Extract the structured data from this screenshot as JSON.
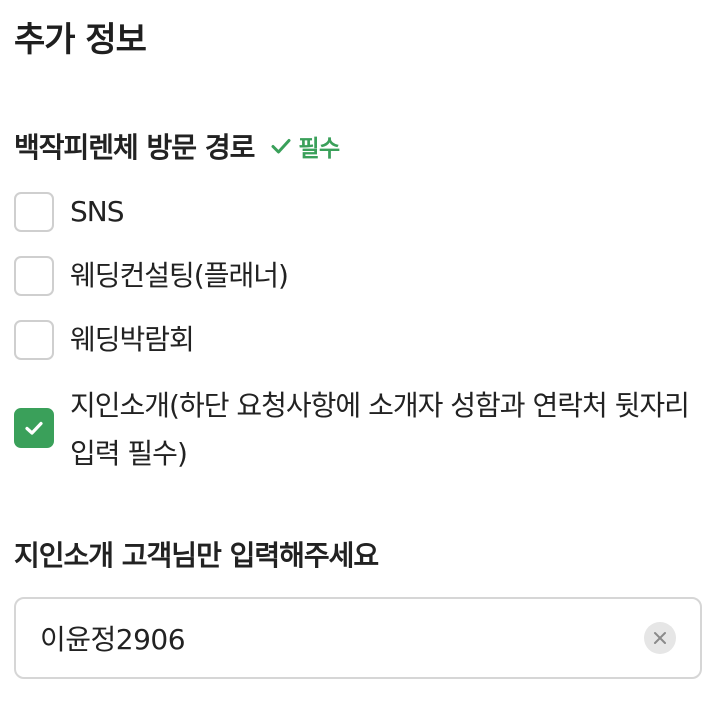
{
  "section": {
    "title": "추가 정보"
  },
  "question": {
    "label": "백작피렌체 방문 경로",
    "required_label": "필수"
  },
  "options": [
    {
      "label": "SNS",
      "checked": false
    },
    {
      "label": "웨딩컨설팅(플래너)",
      "checked": false
    },
    {
      "label": "웨딩박람회",
      "checked": false
    },
    {
      "label": "지인소개(하단 요청사항에 소개자 성함과 연락처 뒷자리 입력 필수)",
      "checked": true
    }
  ],
  "referral": {
    "label": "지인소개 고객님만 입력해주세요",
    "value": "이윤정2906"
  },
  "colors": {
    "accent": "#3aa05a",
    "checkbox_border": "#cfcfcf",
    "input_border": "#d6d6d6"
  },
  "icons": {
    "required": "check-icon",
    "checked": "check-icon",
    "clear": "close-icon"
  }
}
